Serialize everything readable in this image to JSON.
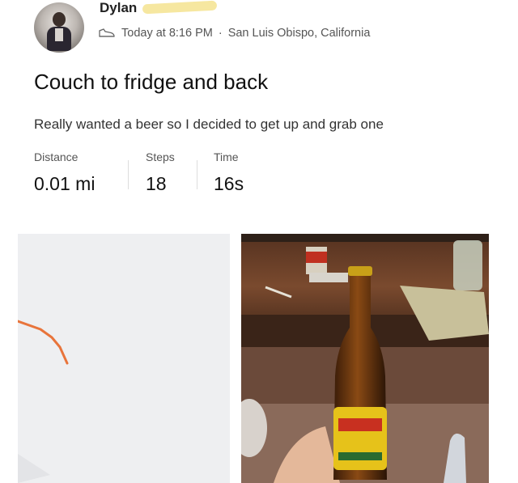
{
  "header": {
    "username": "Dylan",
    "time_text": "Today at 8:16 PM",
    "separator": "·",
    "location": "San Luis Obispo, California",
    "activity_icon": "shoe-icon"
  },
  "post": {
    "title": "Couch to fridge and back",
    "description": "Really wanted a beer so I decided to get up and grab one"
  },
  "stats": [
    {
      "label": "Distance",
      "value": "0.01 mi"
    },
    {
      "label": "Steps",
      "value": "18"
    },
    {
      "label": "Time",
      "value": "16s"
    }
  ],
  "map": {
    "route_color": "#e8743b",
    "background": "#eeeff1"
  },
  "photo": {
    "subject": "beer bottle held over coffee table"
  }
}
